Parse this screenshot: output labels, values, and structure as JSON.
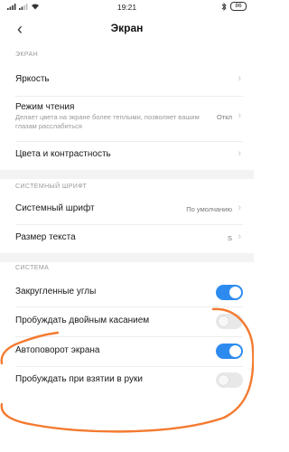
{
  "status_bar": {
    "time": "19:21",
    "battery": "86"
  },
  "header": {
    "title": "Экран"
  },
  "sections": {
    "screen": {
      "label": "ЭКРАН",
      "brightness": "Яркость",
      "reading_mode": {
        "label": "Режим чтения",
        "description": "Делает цвета на экране более теплыми, позволяет вашим глазам расслабиться",
        "value": "Откл"
      },
      "colors": "Цвета и контрастность"
    },
    "system_font": {
      "label": "СИСТЕМНЫЙ ШРИФТ",
      "font": {
        "label": "Системный шрифт",
        "value": "По умолчанию"
      },
      "text_size": {
        "label": "Размер текста",
        "value": "S"
      }
    },
    "system": {
      "label": "СИСТЕМА",
      "items": [
        {
          "label": "Закругленные углы",
          "on": true
        },
        {
          "label": "Пробуждать двойным касанием",
          "on": false
        },
        {
          "label": "Автоповорот экрана",
          "on": true
        },
        {
          "label": "Пробуждать при взятии в руки",
          "on": false
        }
      ]
    }
  },
  "annotation_color": "#f47a30"
}
